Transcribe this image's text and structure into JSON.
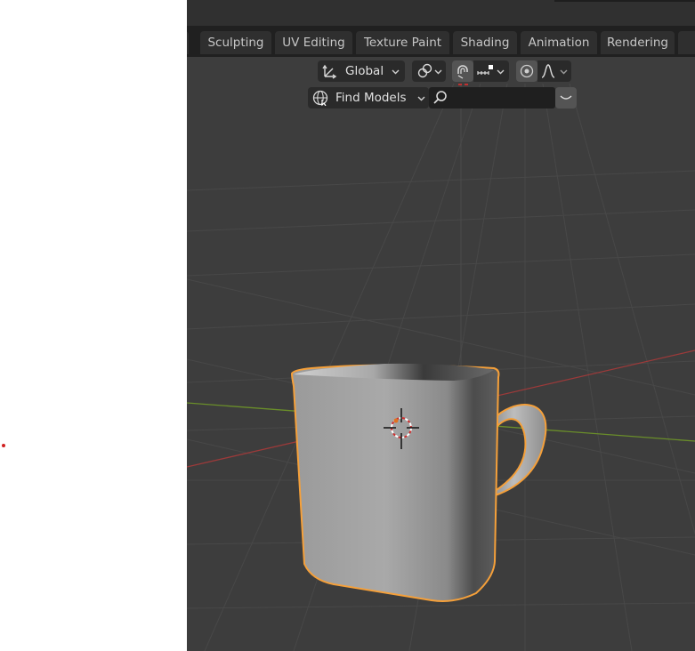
{
  "workspace_tabs": [
    "Sculpting",
    "UV Editing",
    "Texture Paint",
    "Shading",
    "Animation",
    "Rendering"
  ],
  "header": {
    "transform_orientation": "Global"
  },
  "asset_bar": {
    "find_models_label": "Find Models",
    "search_value": ""
  },
  "colors": {
    "selection_outline": "#f5a03a",
    "viewport_bg": "#3d3d3d",
    "x_axis": "#9c3a3a",
    "y_axis": "#6a8e2a"
  },
  "icons": [
    "transform-orientation-icon",
    "pivot-link-icon",
    "snap-magnet-icon",
    "snap-increment-icon",
    "proportional-edit-icon",
    "falloff-curve-icon",
    "globe-icon",
    "search-icon",
    "chevron-down-icon",
    "3d-cursor-icon"
  ]
}
